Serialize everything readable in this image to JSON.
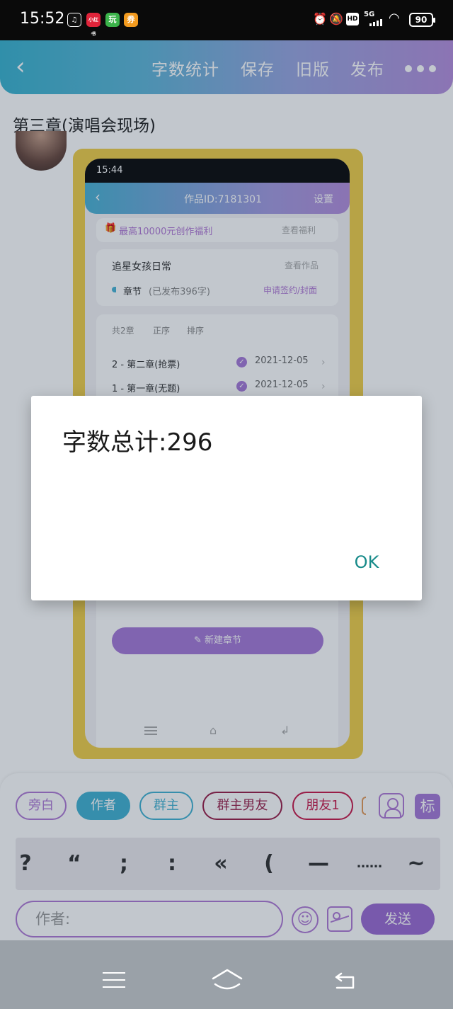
{
  "status_bar": {
    "time": "15:52",
    "app_icons": [
      "music-icon",
      "xiaohongshu-icon",
      "game-icon",
      "coupon-icon"
    ],
    "right_icons": [
      "alarm-icon",
      "mute-icon",
      "hd-icon",
      "signal-5g-icon",
      "wifi-icon"
    ],
    "signal_label": "5G",
    "hd_label": "HD",
    "battery": "90"
  },
  "header": {
    "buttons": [
      "字数统计",
      "保存",
      "旧版",
      "发布"
    ],
    "accent_gradient": [
      "#3bb4d0",
      "#b690dd"
    ]
  },
  "chapter_title": "第三章(演唱会现场)",
  "embedded_screenshot": {
    "time": "15:44",
    "work_id": "作品ID:7181301",
    "settings": "设置",
    "perk_text": "最高10000元创作福利",
    "perk_link": "查看福利",
    "work_title": "追星女孩日常",
    "work_view": "查看作品",
    "chapters_label": "章节",
    "chapters_published": "(已发布396字)",
    "apply_link": "申请签约/封面",
    "list_count": "共2章",
    "list_order": "正序",
    "list_sort": "排序",
    "chapters": [
      {
        "title": "2 - 第二章(抢票)",
        "date": "2021-12-05"
      },
      {
        "title": "1 - 第一章(无题)",
        "date": "2021-12-05"
      }
    ],
    "new_chapter": "新建章节"
  },
  "roles": [
    "旁白",
    "作者",
    "群主",
    "群主男友",
    "朋友1"
  ],
  "tag_label": "标",
  "punctuation": [
    "?",
    "“",
    ";",
    ":",
    "«",
    "(",
    "—",
    "……",
    "~"
  ],
  "input": {
    "value": "作者:"
  },
  "send_label": "发送",
  "dialog": {
    "message": "字数总计:296",
    "ok_label": "OK"
  }
}
